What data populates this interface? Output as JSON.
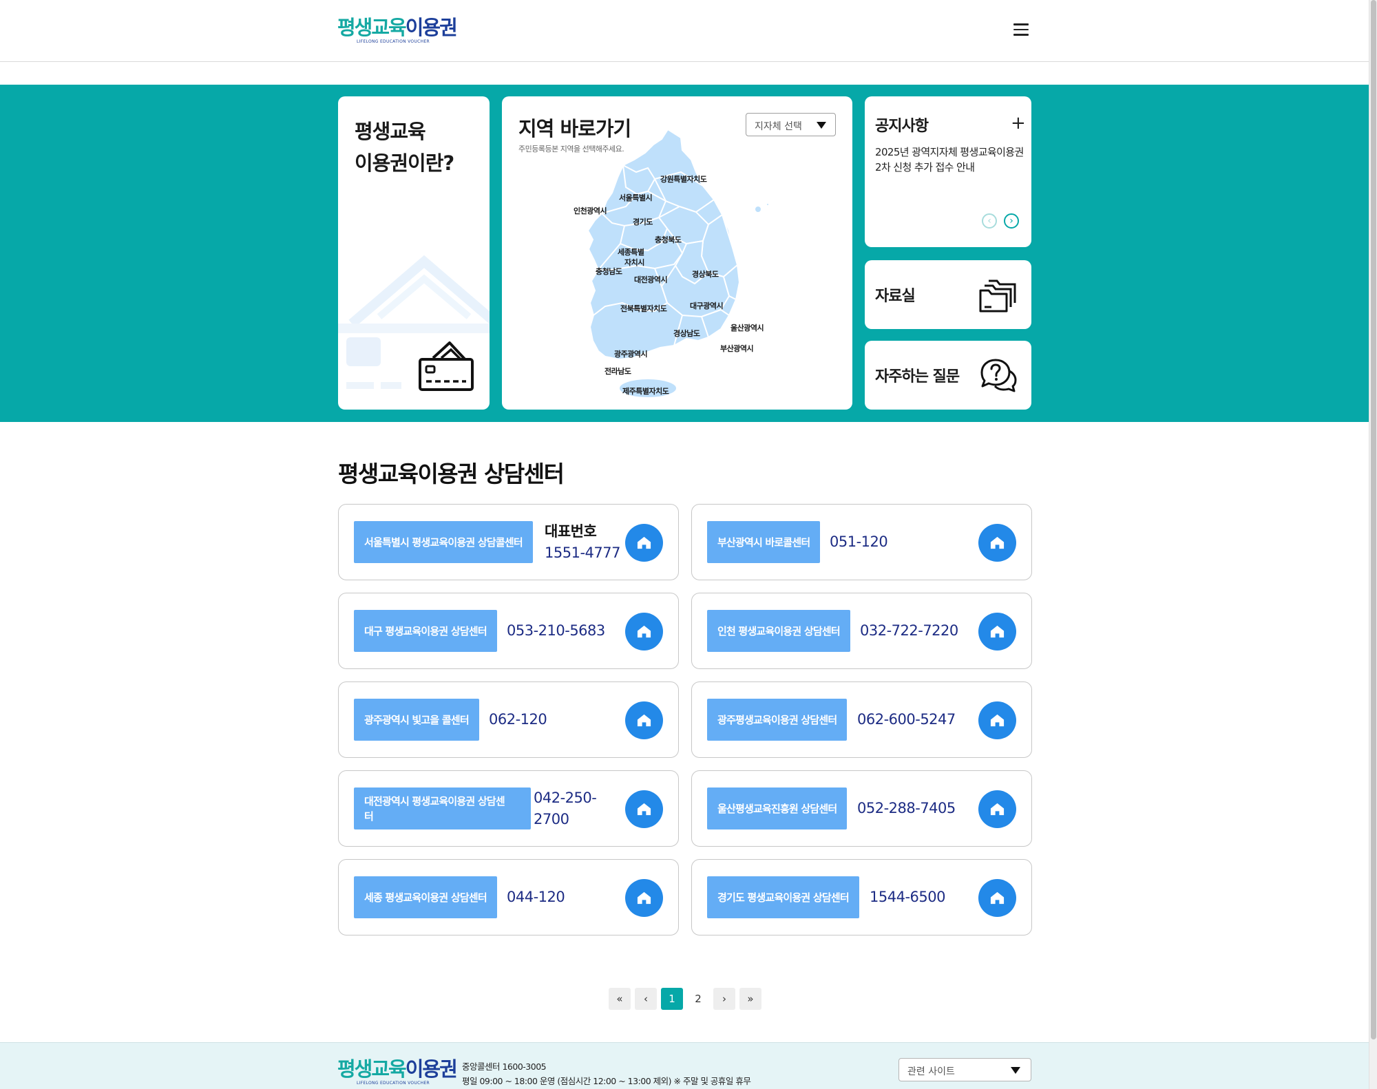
{
  "header": {
    "logo_text_part1": "평생교육",
    "logo_text_part2": "이용권",
    "logo_sub": "LIFELONG EDUCATION VOUCHER",
    "menu_icon": "hamburger-menu-icon"
  },
  "hero": {
    "intro": {
      "title_line1": "평생교육",
      "title_line2": "이용권이란?",
      "icon": "credit-card-icon"
    },
    "map": {
      "title": "지역 바로가기",
      "subtitle": "주민등록등본 지역을 선택해주세요.",
      "select_label": "지자체 선택",
      "regions": {
        "seoul": "서울특별시",
        "gangwon": "강원특별자치도",
        "incheon": "인천광역시",
        "gyeonggi": "경기도",
        "chungbuk": "충청북도",
        "sejong_1": "세종특별",
        "sejong_2": "자치시",
        "chungnam": "충청남도",
        "daejeon": "대전광역시",
        "gyeongbuk": "경상북도",
        "jeonbuk": "전북특별자치도",
        "daegu": "대구광역시",
        "ulsan": "울산광역시",
        "gyeongnam": "경상남도",
        "busan": "부산광역시",
        "gwangju": "광주광역시",
        "jeonnam": "전라남도",
        "jeju": "제주특별자치도"
      },
      "map_color": "#bfe0fb"
    },
    "notice": {
      "title": "공지사항",
      "more": "+",
      "body": "2025년 광역지자체 평생교육이용권 2차 신청 추가 접수 안내",
      "prev": "‹",
      "next": "›"
    },
    "archive": {
      "label": "자료실",
      "icon": "folders-icon"
    },
    "faq": {
      "label": "자주하는 질문",
      "icon": "question-chat-icon"
    }
  },
  "counseling": {
    "title": "평생교육이용권 상담센터",
    "centers": [
      {
        "name": "서울특별시 평생교육이용권 상담콜센터",
        "rep_label": "대표번호",
        "phone": "1551-4777"
      },
      {
        "name": "부산광역시 바로콜센터",
        "phone": "051-120"
      },
      {
        "name": "대구 평생교육이용권 상담센터",
        "phone": "053-210-5683"
      },
      {
        "name": "인천 평생교육이용권 상담센터",
        "phone": "032-722-7220"
      },
      {
        "name": "광주광역시 빛고을 콜센터",
        "phone": "062-120"
      },
      {
        "name": "광주평생교육이용권 상담센터",
        "phone": "062-600-5247"
      },
      {
        "name_line1": "대전광역시 평생교육이용권 상담센",
        "name_line2": "터",
        "phone_line1": "042-250-",
        "phone_line2": "2700"
      },
      {
        "name": "울산평생교육진흥원 상담센터",
        "phone": "052-288-7405"
      },
      {
        "name": "세종 평생교육이용권 상담센터",
        "phone": "044-120"
      },
      {
        "name": "경기도 평생교육이용권 상담센터",
        "phone": "1544-6500"
      }
    ],
    "home_icon": "home-icon",
    "accent_color": "#64adf5",
    "button_color": "#2389e8"
  },
  "pagination": {
    "first": "«",
    "prev": "‹",
    "pages": [
      "1",
      "2"
    ],
    "current": "1",
    "next": "›",
    "last": "»"
  },
  "footer": {
    "call_center": "중앙콜센터 1600-3005",
    "hours": "평일 09:00 ~ 18:00 운영 (점심시간 12:00 ~ 13:00 제외) ※ 주말 및 공휴일 휴무",
    "related_sites": "관련 사이트"
  },
  "colors": {
    "teal": "#06a8a8",
    "navy": "#1d2c84"
  }
}
